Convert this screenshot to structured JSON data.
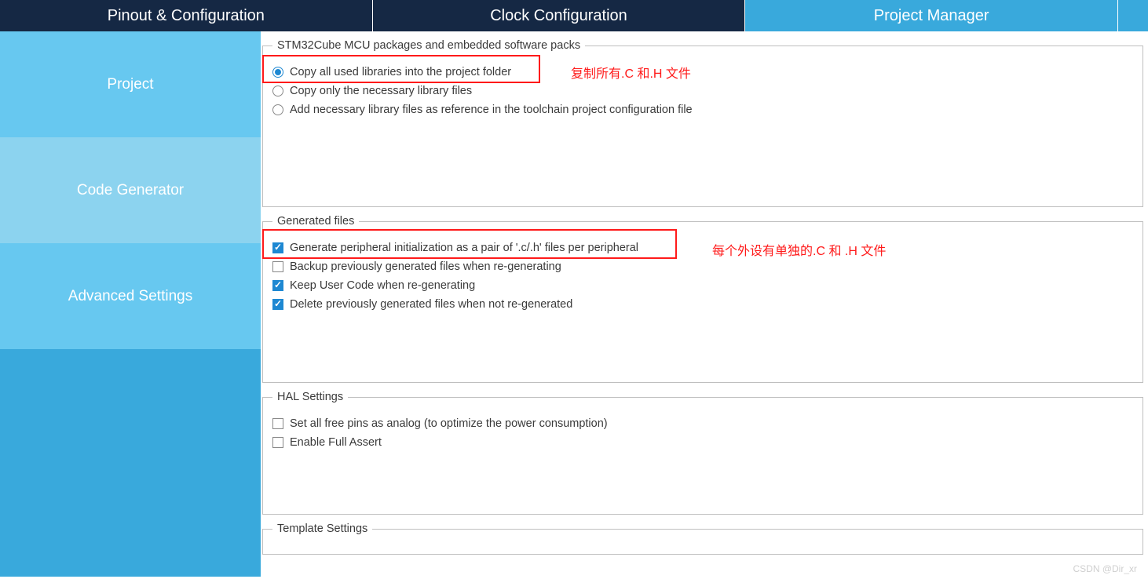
{
  "tabs": {
    "pinout": "Pinout & Configuration",
    "clock": "Clock Configuration",
    "project": "Project Manager"
  },
  "sidebar": {
    "project": "Project",
    "codegen": "Code Generator",
    "advanced": "Advanced Settings"
  },
  "groups": {
    "packages": {
      "legend": "STM32Cube MCU packages and embedded software packs",
      "opt_copy_all": "Copy all used libraries into the project folder",
      "opt_copy_necessary": "Copy only the necessary library files",
      "opt_reference": "Add necessary library files as reference in the toolchain project configuration file"
    },
    "generated": {
      "legend": "Generated files",
      "cb_pair": "Generate peripheral initialization as a pair of '.c/.h' files per peripheral",
      "cb_backup": "Backup previously generated files when re-generating",
      "cb_keep": "Keep User Code when re-generating",
      "cb_delete": "Delete previously generated files when not re-generated"
    },
    "hal": {
      "legend": "HAL Settings",
      "cb_analog": "Set all free pins as analog (to optimize the power consumption)",
      "cb_assert": "Enable Full Assert"
    },
    "template": {
      "legend": "Template Settings"
    }
  },
  "annotations": {
    "ann1": "复制所有.C 和.H 文件",
    "ann2": "每个外设有单独的.C 和 .H 文件"
  },
  "watermark": "CSDN @Dir_xr"
}
